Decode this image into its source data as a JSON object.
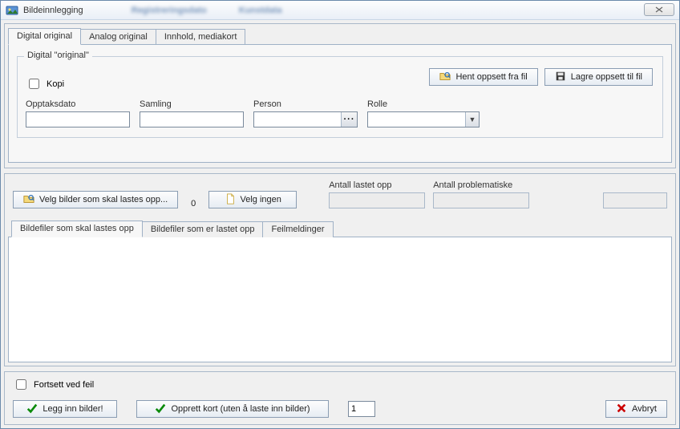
{
  "window": {
    "title": "Bildeinnlegging",
    "bg_hints": [
      "Registreringsdato",
      "Kunstdata"
    ]
  },
  "tabs": {
    "items": [
      {
        "label": "Digital original",
        "active": true
      },
      {
        "label": "Analog original",
        "active": false
      },
      {
        "label": "Innhold, mediakort",
        "active": false
      }
    ]
  },
  "group": {
    "legend": "Digital \"original\"",
    "kopi_label": "Kopi",
    "hent_label": "Hent oppsett fra fil",
    "lagre_label": "Lagre oppsett til fil",
    "fields": {
      "opptaksdato": "Opptaksdato",
      "samling": "Samling",
      "person": "Person",
      "rolle": "Rolle"
    },
    "values": {
      "opptaksdato": "",
      "samling": "",
      "person": "",
      "rolle": ""
    }
  },
  "mid": {
    "velg_bilder": "Velg bilder som skal lastes opp...",
    "count": "0",
    "velg_ingen": "Velg ingen",
    "antall_lastet": "Antall lastet opp",
    "antall_problem": "Antall problematiske"
  },
  "file_tabs": {
    "items": [
      {
        "label": "Bildefiler som skal lastes opp",
        "active": true
      },
      {
        "label": "Bildefiler som er lastet opp",
        "active": false
      },
      {
        "label": "Feilmeldinger",
        "active": false
      }
    ]
  },
  "bottom": {
    "fortsett_label": "Fortsett ved feil",
    "legg_inn": "Legg inn bilder!",
    "opprett_kort": "Opprett kort (uten å laste inn bilder)",
    "count_value": "1",
    "avbryt": "Avbryt"
  }
}
